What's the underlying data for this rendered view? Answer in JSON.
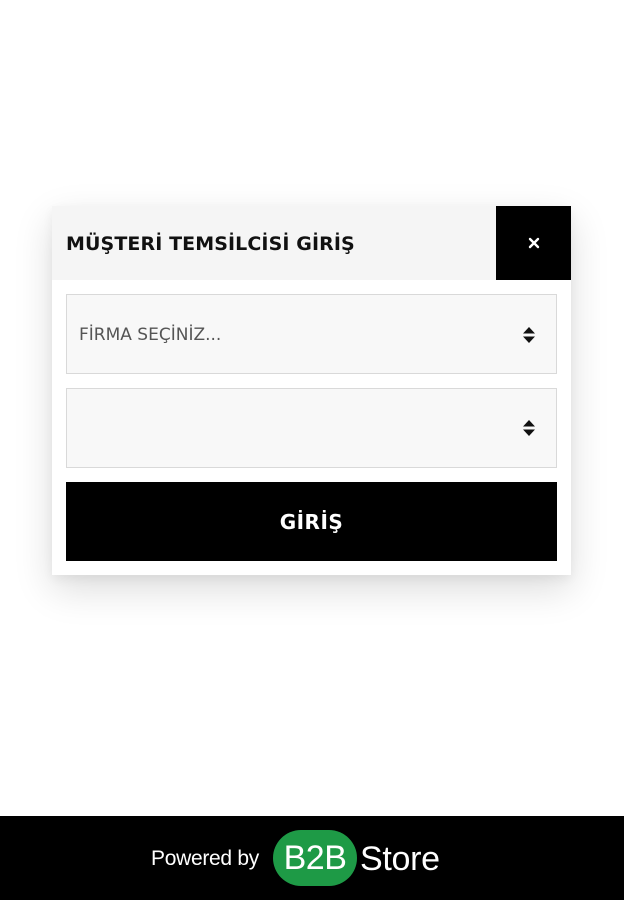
{
  "modal": {
    "title": "MÜŞTERİ TEMSİLCİSİ GİRİŞ",
    "close_icon": "close-icon"
  },
  "form": {
    "company_select": {
      "selected_label": "FİRMA SEÇİNİZ...",
      "icon": "sort-arrows-icon"
    },
    "second_select": {
      "selected_label": "",
      "icon": "sort-arrows-icon"
    },
    "submit_label": "GİRİŞ"
  },
  "footer": {
    "powered_by": "Powered by",
    "logo_b2b": "B2B",
    "logo_store": "Store",
    "colors": {
      "badge_green": "#1e9a46",
      "background": "#000000"
    }
  }
}
